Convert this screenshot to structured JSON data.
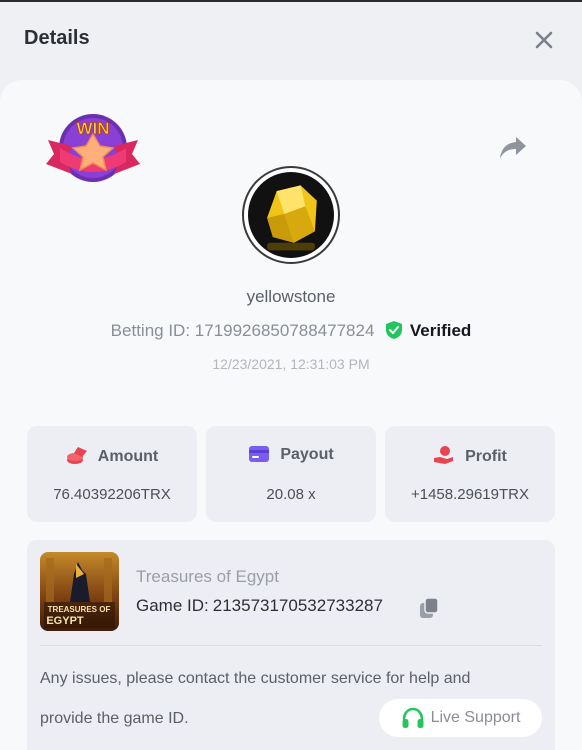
{
  "header": {
    "title": "Details"
  },
  "player": {
    "username": "yellowstone",
    "betting_id_label": "Betting ID:",
    "betting_id": "1719926850788477824",
    "verified_label": "Verified",
    "timestamp": "12/23/2021, 12:31:03 PM"
  },
  "badge": {
    "text": "WIN"
  },
  "stats": [
    {
      "label": "Amount",
      "value": "76.40392206TRX",
      "icon": "coins-icon"
    },
    {
      "label": "Payout",
      "value": "20.08 x",
      "icon": "card-icon"
    },
    {
      "label": "Profit",
      "value": "+1458.29619TRX",
      "icon": "hand-coins-icon"
    }
  ],
  "game": {
    "name": "Treasures of Egypt",
    "id_label": "Game ID:",
    "id": "213573170532733287",
    "thumb_text_1": "TREASURES OF",
    "thumb_text_2": "EGYPT"
  },
  "notice": {
    "line1": "Any issues, please contact the customer service for help and",
    "line2": "provide the game ID."
  },
  "live_support": {
    "label": "Live Support"
  },
  "colors": {
    "accent_red": "#e8434f",
    "accent_purple": "#7a5cf0",
    "verified_green": "#22c55e",
    "support_green": "#22c55e"
  }
}
